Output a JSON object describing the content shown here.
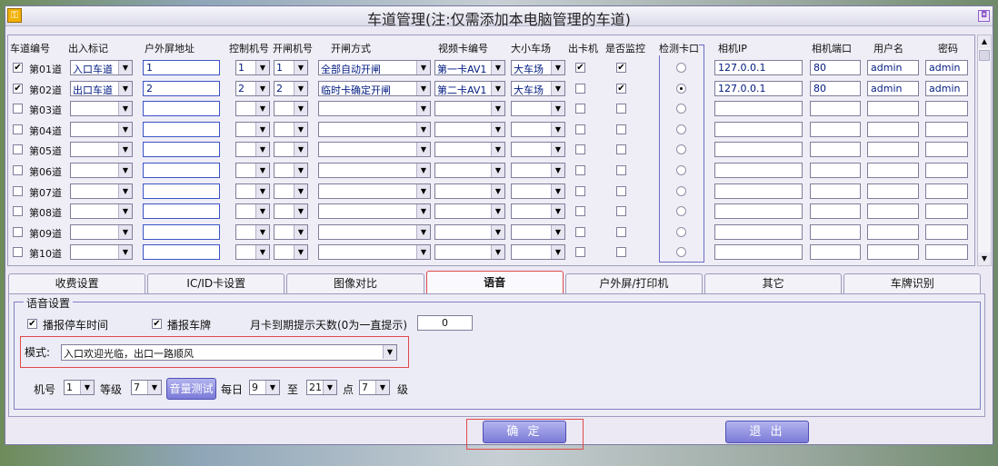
{
  "window": {
    "title": "车道管理(注:仅需添加本电脑管理的车道)",
    "close_glyph": "◘"
  },
  "headers": [
    "车道编号",
    "出入标记",
    "户外屏地址",
    "控制机号",
    "开闸机号",
    "开闸方式",
    "视频卡编号",
    "大小车场",
    "出卡机",
    "是否监控",
    "检测卡口",
    "相机IP",
    "相机端口",
    "用户名",
    "密码"
  ],
  "lanes": [
    {
      "checked": true,
      "name": "第01道",
      "inout": "入口车道",
      "screen": "1",
      "ctrl": "1",
      "gate": "1",
      "mode": "全部自动开闸",
      "video": "第一卡AV1",
      "park": "大车场",
      "card": true,
      "monitor": true,
      "detect": false,
      "ip": "127.0.0.1",
      "port": "80",
      "user": "admin",
      "pwd": "admin"
    },
    {
      "checked": true,
      "name": "第02道",
      "inout": "出口车道",
      "screen": "2",
      "ctrl": "2",
      "gate": "2",
      "mode": "临时卡确定开闸",
      "video": "第二卡AV1",
      "park": "大车场",
      "card": false,
      "monitor": true,
      "detect": true,
      "ip": "127.0.0.1",
      "port": "80",
      "user": "admin",
      "pwd": "admin"
    },
    {
      "checked": false,
      "name": "第03道",
      "inout": "",
      "screen": "",
      "ctrl": "",
      "gate": "",
      "mode": "",
      "video": "",
      "park": "",
      "card": false,
      "monitor": false,
      "detect": false,
      "ip": "",
      "port": "",
      "user": "",
      "pwd": ""
    },
    {
      "checked": false,
      "name": "第04道",
      "inout": "",
      "screen": "",
      "ctrl": "",
      "gate": "",
      "mode": "",
      "video": "",
      "park": "",
      "card": false,
      "monitor": false,
      "detect": false,
      "ip": "",
      "port": "",
      "user": "",
      "pwd": ""
    },
    {
      "checked": false,
      "name": "第05道",
      "inout": "",
      "screen": "",
      "ctrl": "",
      "gate": "",
      "mode": "",
      "video": "",
      "park": "",
      "card": false,
      "monitor": false,
      "detect": false,
      "ip": "",
      "port": "",
      "user": "",
      "pwd": ""
    },
    {
      "checked": false,
      "name": "第06道",
      "inout": "",
      "screen": "",
      "ctrl": "",
      "gate": "",
      "mode": "",
      "video": "",
      "park": "",
      "card": false,
      "monitor": false,
      "detect": false,
      "ip": "",
      "port": "",
      "user": "",
      "pwd": ""
    },
    {
      "checked": false,
      "name": "第07道",
      "inout": "",
      "screen": "",
      "ctrl": "",
      "gate": "",
      "mode": "",
      "video": "",
      "park": "",
      "card": false,
      "monitor": false,
      "detect": false,
      "ip": "",
      "port": "",
      "user": "",
      "pwd": ""
    },
    {
      "checked": false,
      "name": "第08道",
      "inout": "",
      "screen": "",
      "ctrl": "",
      "gate": "",
      "mode": "",
      "video": "",
      "park": "",
      "card": false,
      "monitor": false,
      "detect": false,
      "ip": "",
      "port": "",
      "user": "",
      "pwd": ""
    },
    {
      "checked": false,
      "name": "第09道",
      "inout": "",
      "screen": "",
      "ctrl": "",
      "gate": "",
      "mode": "",
      "video": "",
      "park": "",
      "card": false,
      "monitor": false,
      "detect": false,
      "ip": "",
      "port": "",
      "user": "",
      "pwd": ""
    },
    {
      "checked": false,
      "name": "第10道",
      "inout": "",
      "screen": "",
      "ctrl": "",
      "gate": "",
      "mode": "",
      "video": "",
      "park": "",
      "card": false,
      "monitor": false,
      "detect": false,
      "ip": "",
      "port": "",
      "user": "",
      "pwd": ""
    }
  ],
  "tabs": [
    "收费设置",
    "IC/ID卡设置",
    "图像对比",
    "语音",
    "户外屏/打印机",
    "其它",
    "车牌识别"
  ],
  "active_tab": 3,
  "voice": {
    "group_title": "语音设置",
    "announce_time_label": "播报停车时间",
    "announce_time": true,
    "announce_plate_label": "播报车牌",
    "announce_plate": true,
    "month_days_label": "月卡到期提示天数(0为一直提示)",
    "month_days": "0",
    "mode_label": "模式:",
    "mode_value": "入口欢迎光临，出口一路顺风",
    "machine_label": "机号",
    "machine_value": "1",
    "grade_label": "等级",
    "grade_value": "7",
    "test_button": "音量测试",
    "daily_label": "每日",
    "daily_from": "9",
    "to_label": "至",
    "daily_to": "21",
    "point_label": "点",
    "level_value": "7",
    "level_label": "级"
  },
  "buttons": {
    "ok": "确 定",
    "exit": "退 出"
  },
  "colors": {
    "accent": "#7a7ad8",
    "highlight": "#e04a4a",
    "window_bg": "#ece9f4"
  }
}
